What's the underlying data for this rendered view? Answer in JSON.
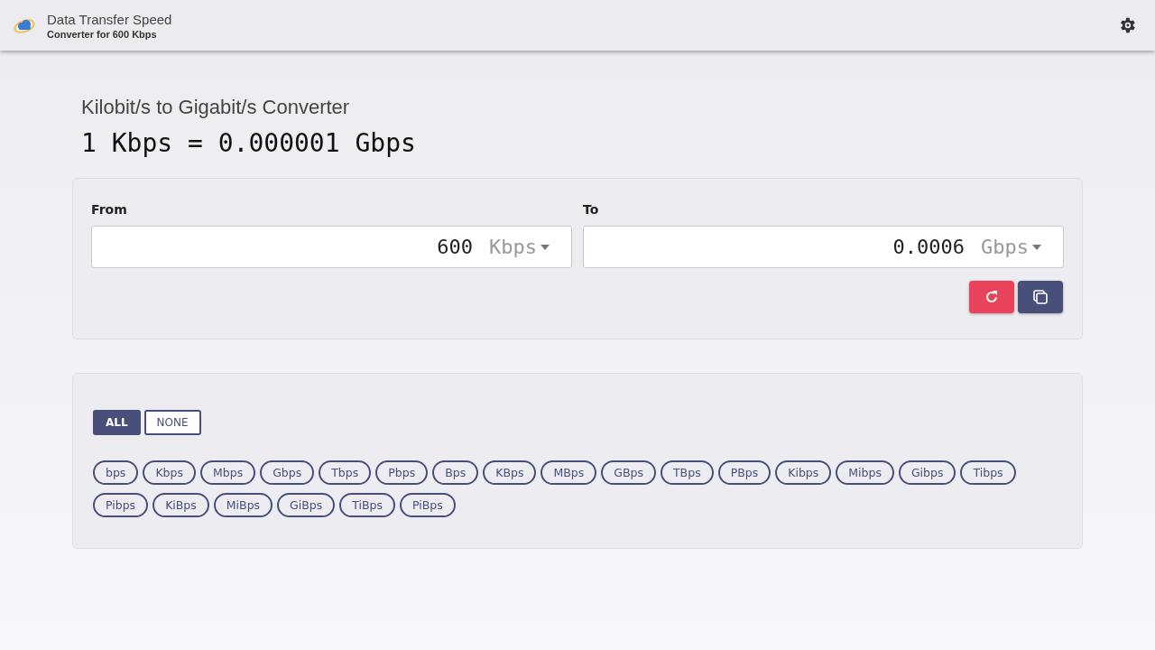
{
  "header": {
    "title": "Data Transfer Speed",
    "subtitle": "Converter for 600 Kbps"
  },
  "converter": {
    "title": "Kilobit/s to Gigabit/s Converter",
    "equation": "1 Kbps = 0.000001 Gbps",
    "from": {
      "label": "From",
      "value": "600",
      "unit": "Kbps"
    },
    "to": {
      "label": "To",
      "value": "0.0006",
      "unit": "Gbps"
    }
  },
  "filter": {
    "toggles": [
      {
        "label": "ALL",
        "selected": true
      },
      {
        "label": "NONE",
        "selected": false
      }
    ],
    "units": [
      {
        "label": "bps",
        "selected": false
      },
      {
        "label": "Kbps",
        "selected": false
      },
      {
        "label": "Mbps",
        "selected": false
      },
      {
        "label": "Gbps",
        "selected": false
      },
      {
        "label": "Tbps",
        "selected": false
      },
      {
        "label": "Pbps",
        "selected": false
      },
      {
        "label": "Bps",
        "selected": false
      },
      {
        "label": "KBps",
        "selected": false
      },
      {
        "label": "MBps",
        "selected": false
      },
      {
        "label": "GBps",
        "selected": false
      },
      {
        "label": "TBps",
        "selected": false
      },
      {
        "label": "PBps",
        "selected": false
      },
      {
        "label": "Kibps",
        "selected": false
      },
      {
        "label": "Mibps",
        "selected": false
      },
      {
        "label": "Gibps",
        "selected": false
      },
      {
        "label": "Tibps",
        "selected": false
      },
      {
        "label": "Pibps",
        "selected": false
      },
      {
        "label": "KiBps",
        "selected": false
      },
      {
        "label": "MiBps",
        "selected": false
      },
      {
        "label": "GiBps",
        "selected": false
      },
      {
        "label": "TiBps",
        "selected": false
      },
      {
        "label": "PiBps",
        "selected": false
      }
    ]
  }
}
